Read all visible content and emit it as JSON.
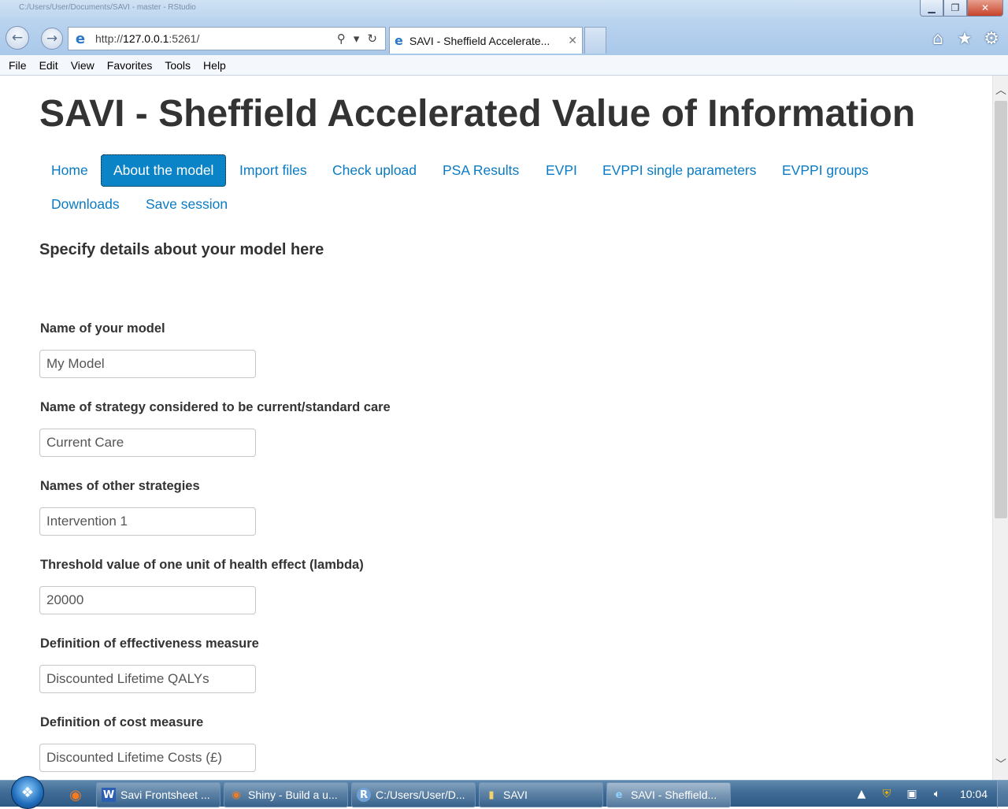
{
  "browser": {
    "title_text": "C:/Users/User/Documents/SAVI - master - RStudio",
    "url_prefix": "http://",
    "url_host": "127.0.0.1",
    "url_suffix": ":5261/",
    "tab_title": "SAVI - Sheffield Accelerate...",
    "menu": [
      "File",
      "Edit",
      "View",
      "Favorites",
      "Tools",
      "Help"
    ]
  },
  "page": {
    "title": "SAVI - Sheffield Accelerated Value of Information",
    "nav": [
      "Home",
      "About the model",
      "Import files",
      "Check upload",
      "PSA Results",
      "EVPI",
      "EVPPI single parameters",
      "EVPPI groups",
      "Downloads",
      "Save session"
    ],
    "active_nav": "About the model",
    "section_heading": "Specify details about your model here",
    "fields": [
      {
        "label": "Name of your model",
        "value": "My Model"
      },
      {
        "label": "Name of strategy considered to be current/standard care",
        "value": "Current Care"
      },
      {
        "label": "Names of other strategies",
        "value": "Intervention 1"
      },
      {
        "label": "Threshold value of one unit of health effect (lambda)",
        "value": "20000"
      },
      {
        "label": "Definition of effectiveness measure",
        "value": "Discounted Lifetime QALYs"
      },
      {
        "label": "Definition of cost measure",
        "value": "Discounted Lifetime Costs (£)"
      }
    ]
  },
  "taskbar": {
    "items": [
      {
        "label": "Savi Frontsheet ...",
        "icon": "word-icon"
      },
      {
        "label": "Shiny - Build a u...",
        "icon": "firefox-icon"
      },
      {
        "label": "C:/Users/User/D...",
        "icon": "rstudio-icon"
      },
      {
        "label": "SAVI",
        "icon": "folder-icon"
      },
      {
        "label": "SAVI - Sheffield...",
        "icon": "ie-icon"
      }
    ],
    "clock": "10:04"
  },
  "colors": {
    "link": "#0a7bc4",
    "active_pill": "#0a84c6",
    "heading": "#333333"
  }
}
